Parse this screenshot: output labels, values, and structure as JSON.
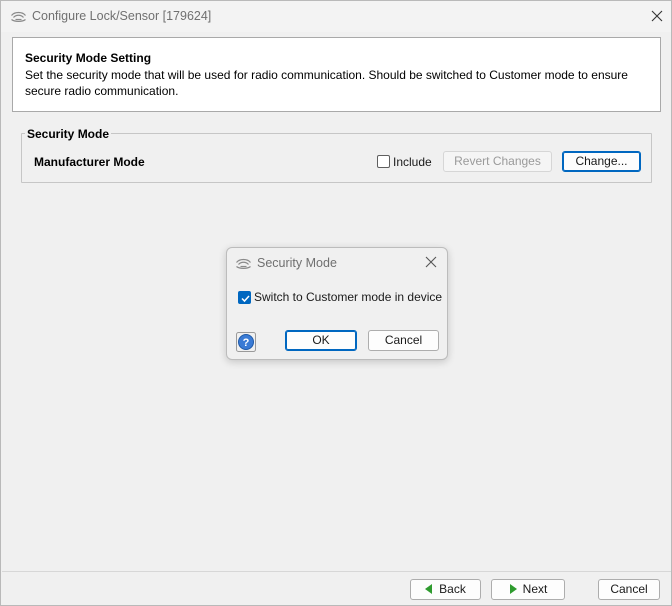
{
  "window": {
    "title": "Configure Lock/Sensor [179624]"
  },
  "header": {
    "title": "Security Mode Setting",
    "description": "Set the security mode that will be used for radio communication. Should be switched to Customer mode to ensure secure radio communication."
  },
  "security_group": {
    "legend": "Security Mode",
    "current_mode": "Manufacturer Mode",
    "include_label": "Include",
    "include_checked": false,
    "revert_label": "Revert Changes",
    "change_label": "Change..."
  },
  "dialog": {
    "title": "Security Mode",
    "checkbox_label": "Switch to Customer mode in device",
    "checkbox_checked": true,
    "ok_label": "OK",
    "cancel_label": "Cancel"
  },
  "footer": {
    "back_label": "Back",
    "next_label": "Next",
    "cancel_label": "Cancel"
  },
  "icons": {
    "app": "signal-waves-icon",
    "close": "close-icon",
    "help": "help-icon",
    "back": "arrow-left-icon",
    "next": "arrow-right-icon"
  },
  "colors": {
    "accent": "#0067c0",
    "arrow_green": "#2e9b2e"
  }
}
